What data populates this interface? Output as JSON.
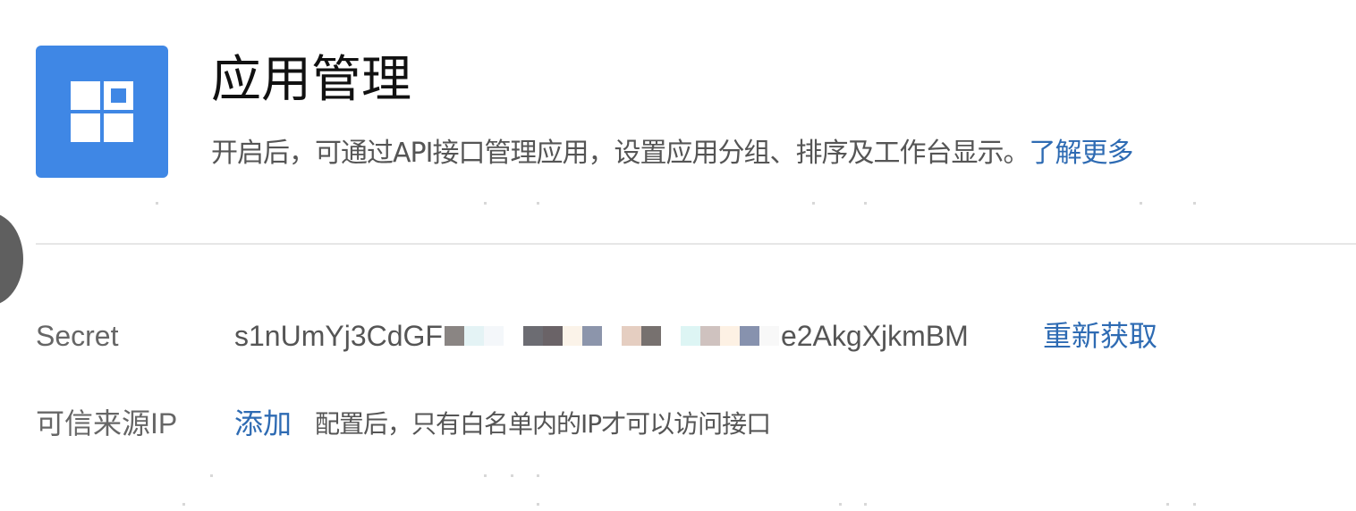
{
  "header": {
    "title": "应用管理",
    "description": "开启后，可通过API接口管理应用，设置应用分组、排序及工作台显示。",
    "learn_more": "了解更多",
    "icon": "app-grid-icon",
    "accent_color": "#3f87e5"
  },
  "secret": {
    "label": "Secret",
    "value_prefix": "s1nUmYj3CdGF",
    "value_suffix": "e2AkgXjkmBM",
    "refresh_label": "重新获取"
  },
  "trusted_ip": {
    "label": "可信来源IP",
    "add_label": "添加",
    "hint": "配置后，只有白名单内的IP才可以访问接口"
  },
  "colors": {
    "link": "#2e6bb3",
    "text": "#555555",
    "label": "#666666"
  }
}
